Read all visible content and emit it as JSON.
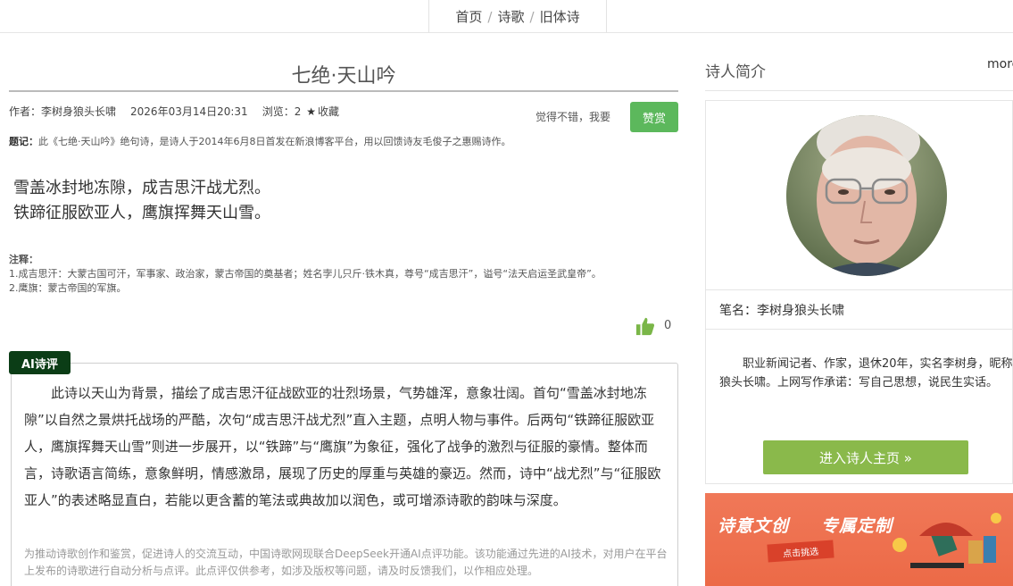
{
  "breadcrumb": {
    "home": "首页",
    "sep1": "/",
    "section": "诗歌",
    "sep2": "/",
    "category": "旧体诗"
  },
  "poem": {
    "title": "七绝·天山吟",
    "author_label": "作者：",
    "author": "李树身狼头长啸",
    "datetime": "2026年03月14日20:31",
    "views_label": "浏览：",
    "views": "2",
    "favorite": "收藏",
    "like_prompt": "觉得不错，我要",
    "zan_button": "赞赏",
    "tiji_label": "题记：",
    "tiji": "此《七绝·天山吟》绝句诗，是诗人于2014年6月8日首发在新浪博客平台，用以回馈诗友毛俊子之惠赐诗作。",
    "lines": [
      "雪盖冰封地冻隙，成吉思汗战尤烈。",
      "铁蹄征服欧亚人，鹰旗挥舞天山雪。"
    ],
    "notes_label": "注释：",
    "notes": [
      "1.成吉思汗：大蒙古国可汗，军事家、政治家，蒙古帝国的奠基者；姓名孛儿只斤·铁木真，尊号“成吉思汗”，谥号“法天启运圣武皇帝”。",
      "2.鹰旗：蒙古帝国的军旗。"
    ],
    "like_count": "0"
  },
  "ai": {
    "tag": "AI诗评",
    "review": "此诗以天山为背景，描绘了成吉思汗征战欧亚的壮烈场景，气势雄浑，意象壮阔。首句“雪盖冰封地冻隙”以自然之景烘托战场的严酷，次句“成吉思汗战尤烈”直入主题，点明人物与事件。后两句“铁蹄征服欧亚人，鹰旗挥舞天山雪”则进一步展开，以“铁蹄”与“鹰旗”为象征，强化了战争的激烈与征服的豪情。整体而言，诗歌语言简练，意象鲜明，情感激昂，展现了历史的厚重与英雄的豪迈。然而，诗中“战尤烈”与“征服欧亚人”的表述略显直白，若能以更含蓄的笔法或典故加以润色，或可增添诗歌的韵味与深度。",
    "disclaimer": "为推动诗歌创作和鉴赏，促进诗人的交流互动，中国诗歌网现联合DeepSeek开通AI点评功能。该功能通过先进的AI技术，对用户在平台上发布的诗歌进行自动分析与点评。此点评仅供参考，如涉及版权等问题，请及时反馈我们，以作相应处理。"
  },
  "sidebar": {
    "heading": "诗人简介",
    "more": "more",
    "pen_name_label": "笔名：",
    "pen_name": "李树身狼头长啸",
    "bio": "职业新闻记者、作家，退休20年，实名李树身，昵称狼头长啸。上网写作承诺：写自己思想，说民生实话。",
    "home_button": "进入诗人主页 »",
    "banner_title1": "诗意文创",
    "banner_title2": "专属定制",
    "banner_ribbon": "点击挑选"
  },
  "colors": {
    "zan_green": "#5cb85c",
    "ai_tag": "#0b3d16",
    "home_green": "#8ab94b",
    "banner": "#ec6a47"
  }
}
